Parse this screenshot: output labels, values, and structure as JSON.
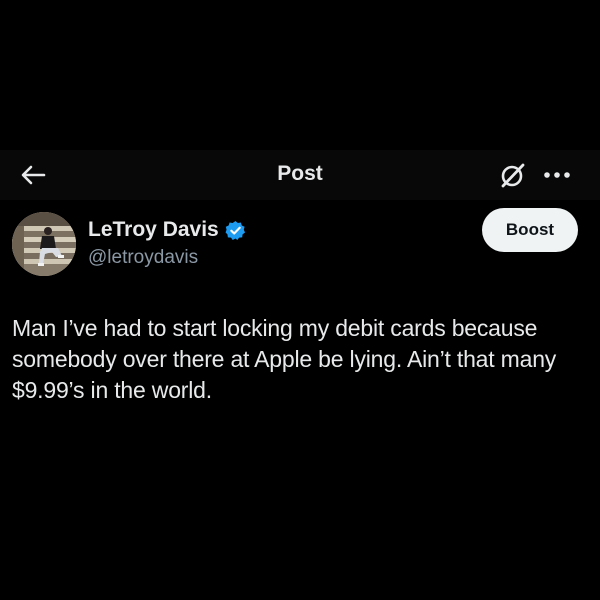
{
  "header": {
    "back_icon": "arrow-left-icon",
    "title": "Post",
    "grok_icon": "grok-icon",
    "more_icon": "more-horizontal-icon"
  },
  "author": {
    "display_name": "LeTroy Davis",
    "handle": "@letroydavis",
    "verified_icon": "verified-badge-icon",
    "verified_color": "#1d9bf0",
    "boost_label": "Boost"
  },
  "post": {
    "text": "Man I’ve had to start locking my debit cards because somebody over there at Apple be lying. Ain’t that many $9.99’s in the world."
  },
  "colors": {
    "background": "#000000",
    "text_primary": "#e7e9ea",
    "text_secondary": "#8b98a5",
    "button_bg": "#eff3f4",
    "button_text": "#0f1419"
  }
}
